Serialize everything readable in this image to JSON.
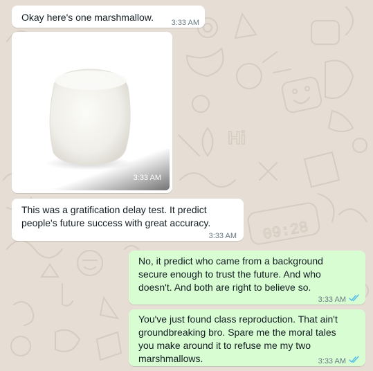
{
  "messages": [
    {
      "direction": "incoming",
      "type": "text",
      "text": "Okay here's one marshmallow.",
      "time": "3:33 AM"
    },
    {
      "direction": "incoming",
      "type": "image",
      "image": "marshmallow-photo",
      "time": "3:33 AM"
    },
    {
      "direction": "incoming",
      "type": "text",
      "lines": [
        "This was a gratification delay test. It predict",
        "people's future success with great accuracy."
      ],
      "time": "3:33 AM"
    },
    {
      "direction": "outgoing",
      "type": "text",
      "lines": [
        "No, it predict who came from a background",
        "secure enough to trust the future. And who",
        "doesn't. And both are right to believe so."
      ],
      "time": "3:33 AM",
      "status": "read"
    },
    {
      "direction": "outgoing",
      "type": "text",
      "lines": [
        "You've just found class reproduction. That ain't",
        "groundbreaking bro. Spare me the moral tales",
        "you make around it to refuse me my two",
        "marshmallows."
      ],
      "time": "3:33 AM",
      "status": "read"
    }
  ],
  "wallpaper": {
    "text": "Hi",
    "clock": "09:28"
  },
  "colors": {
    "chat_background": "#e6ddd4",
    "incoming_bubble": "#ffffff",
    "outgoing_bubble": "#d9fdd3",
    "timestamp": "#667781",
    "read_ticks": "#53bdeb"
  }
}
